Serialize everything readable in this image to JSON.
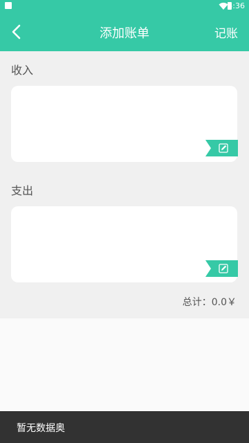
{
  "status_bar": {
    "time": "5:36",
    "color": "#36c9a6"
  },
  "header": {
    "title": "添加账单",
    "back_icon": "chevron-left-icon",
    "action_label": "记账",
    "color": "#36c9a6"
  },
  "income": {
    "label": "收入",
    "edit_icon": "edit-icon"
  },
  "expense": {
    "label": "支出",
    "edit_icon": "edit-icon"
  },
  "summary": {
    "total_text": "总计：0.0￥"
  },
  "toast": {
    "message": "暂无数据奥"
  }
}
